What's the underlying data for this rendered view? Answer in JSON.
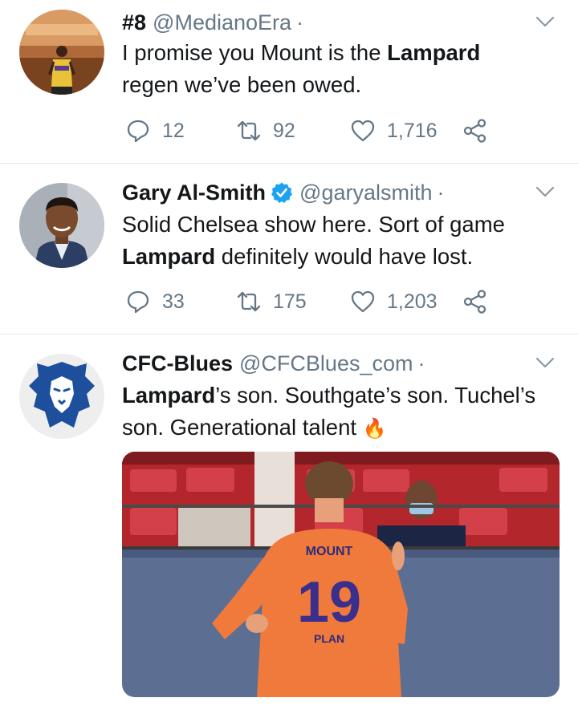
{
  "tweets": [
    {
      "name": "#8",
      "handle": "@MedianoEra",
      "dot": "·",
      "text_parts": [
        "I promise you Mount is the ",
        "Lampard",
        " regen we’ve been owed."
      ],
      "replies": "12",
      "retweets": "92",
      "likes": "1,716"
    },
    {
      "name": "Gary Al-Smith",
      "handle": "@garyalsmith",
      "dot": "·",
      "text_parts": [
        "Solid Chelsea show here. Sort of game ",
        "Lampard",
        " definitely would have lost."
      ],
      "replies": "33",
      "retweets": "175",
      "likes": "1,203"
    },
    {
      "name": "CFC-Blues",
      "handle": "@CFCBlues_com",
      "dot": "·",
      "text_parts": [
        "Lampard",
        "’s son. Southgate’s son. Tuchel’s son. Generational talent"
      ],
      "emoji": "🔥",
      "media": {
        "jersey_name": "MOUNT",
        "jersey_number": "19",
        "sponsor": "PLAN"
      }
    }
  ],
  "icons": [
    "reply-icon",
    "retweet-icon",
    "like-icon",
    "share-icon",
    "chevron-down-icon",
    "verified-badge-icon"
  ],
  "colors": {
    "text": "#14171a",
    "secondary": "#657786",
    "verified": "#1da1f2",
    "separator": "#e1e8ed"
  }
}
